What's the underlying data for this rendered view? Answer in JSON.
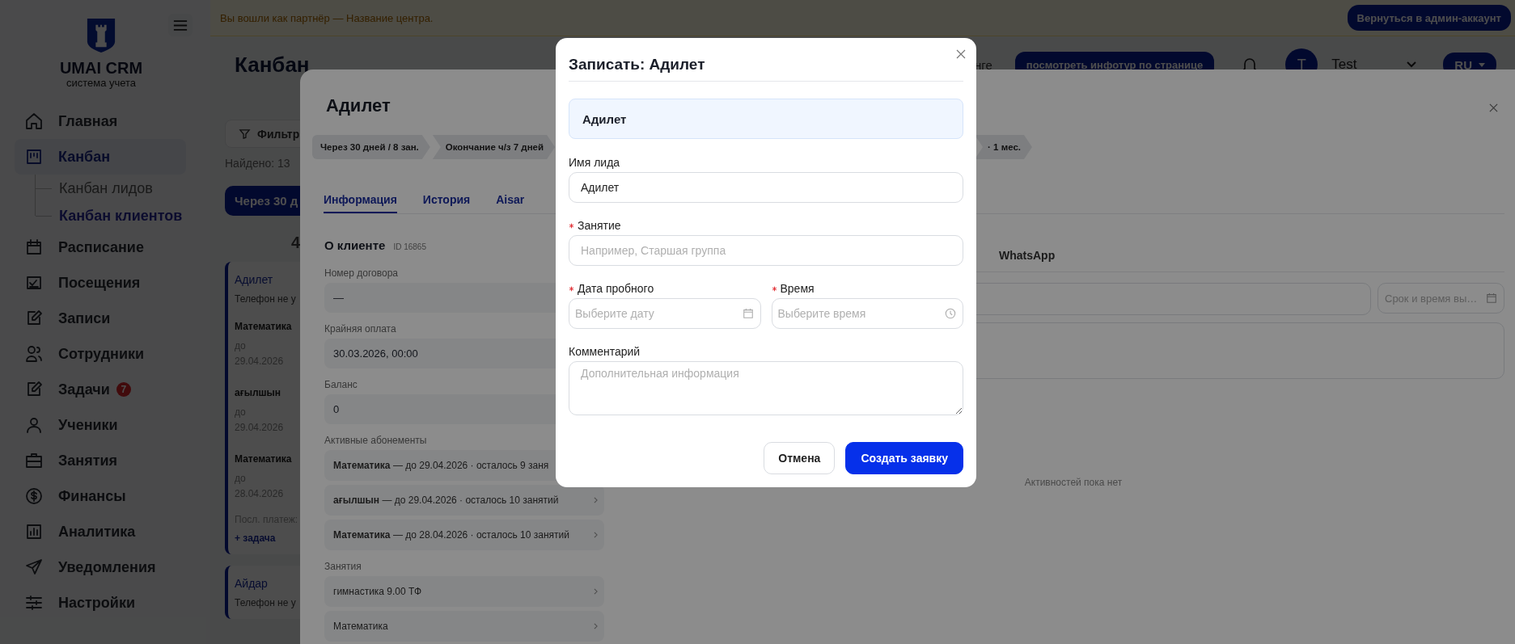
{
  "banner": {
    "text": "Вы вошли как партнёр — Название центра.",
    "button": "Вернуться в админ-аккаунт"
  },
  "sidebar": {
    "brand": "UMAI CRM",
    "tagline": "система учета",
    "items": [
      {
        "label": "Главная",
        "selected": false
      },
      {
        "label": "Канбан",
        "selected": true,
        "children": [
          {
            "label": "Канбан лидов",
            "selected": false
          },
          {
            "label": "Канбан клиентов",
            "selected": true
          }
        ]
      },
      {
        "label": "Расписание",
        "selected": false
      },
      {
        "label": "Посещения",
        "selected": false
      },
      {
        "label": "Записи",
        "selected": false
      },
      {
        "label": "Сотрудники",
        "selected": false
      },
      {
        "label": "Задачи",
        "selected": false,
        "badge": "7"
      },
      {
        "label": "Ученики",
        "selected": false
      },
      {
        "label": "Занятия",
        "selected": false
      },
      {
        "label": "Финансы",
        "selected": false
      },
      {
        "label": "Аналитика",
        "selected": false
      },
      {
        "label": "Уведомления",
        "selected": false
      },
      {
        "label": "Настройки",
        "selected": false
      }
    ]
  },
  "header": {
    "title": "Канбан",
    "partial_text": "нге",
    "tour_button": "посмотреть инфотур по странице",
    "user_initial": "T",
    "user_name": "Test",
    "language": "RU"
  },
  "kanban": {
    "filter_button": "Фильтр",
    "found_label": "Найдено:",
    "found_count": "13",
    "column_title": "Через 30 д",
    "column_count": "4",
    "cards": [
      {
        "name": "Адилет",
        "phone": "Телефон не у",
        "subscriptions": [
          {
            "subject": "Математика",
            "prefix": "до",
            "date": "29.04.2026"
          },
          {
            "subject": "ағылшын",
            "prefix": "до",
            "date": "29.04.2026"
          },
          {
            "subject": "Математика",
            "prefix": "до",
            "date": "28.04.2026"
          }
        ],
        "last_payment": "Посл. платеж:",
        "add_task": "+ задача"
      },
      {
        "name": "Айдар",
        "phone": "Телефон не у"
      }
    ]
  },
  "drawer": {
    "title": "Адилет",
    "stages": [
      "Через 30 дней / 8 зан.",
      "Окончание ч/з 7 дней",
      "· 1 мес."
    ],
    "tabs": [
      {
        "label": "Информация",
        "selected": true
      },
      {
        "label": "История",
        "selected": false
      },
      {
        "label": "Aisar",
        "selected": false
      }
    ],
    "client": {
      "heading": "О клиенте",
      "id": "ID 16865",
      "fields": [
        {
          "label": "Номер договора",
          "value": "—"
        },
        {
          "label": "Крайняя оплата",
          "value": "30.03.2026, 00:00"
        },
        {
          "label": "Баланс",
          "value": "0"
        }
      ],
      "subscriptions_label": "Активные абонементы",
      "subscriptions": [
        {
          "text": "**Математика** — до 29.04.2026 · осталось 9 заня",
          "chevron": false
        },
        {
          "text": "**ағылшын** — до 29.04.2026 · осталось 10 занятий",
          "chevron": true
        },
        {
          "text": "**Математика** — до 28.04.2026 · осталось 10 занятий",
          "chevron": true
        }
      ],
      "lessons_label": "Занятия",
      "lessons": [
        {
          "text": "гимнастика 9.00 ТФ",
          "chevron": true
        },
        {
          "text": "Математика",
          "chevron": true
        }
      ]
    },
    "activity": {
      "channel_tabs": [
        "WhatsApp"
      ],
      "deadline_placeholder": "Срок и время вы…",
      "empty_text": "Активностей пока нет"
    }
  },
  "modal": {
    "title": "Записать: Адилет",
    "lead": "Адилет",
    "fields": [
      {
        "kind": "text",
        "label": "Имя лида",
        "required": false,
        "value": "Адилет"
      },
      {
        "kind": "text",
        "label": "Занятие",
        "required": true,
        "placeholder": "Например, Старшая группа"
      },
      {
        "kind": "date",
        "label": "Дата пробного",
        "required": true,
        "placeholder": "Выберите дату"
      },
      {
        "kind": "time",
        "label": "Время",
        "required": true,
        "placeholder": "Выберите время"
      },
      {
        "kind": "textarea",
        "label": "Комментарий",
        "required": false,
        "placeholder": "Дополнительная информация"
      }
    ],
    "buttons": [
      {
        "kind": "secondary",
        "label": "Отмена"
      },
      {
        "kind": "primary",
        "label": "Создать заявку"
      }
    ]
  }
}
